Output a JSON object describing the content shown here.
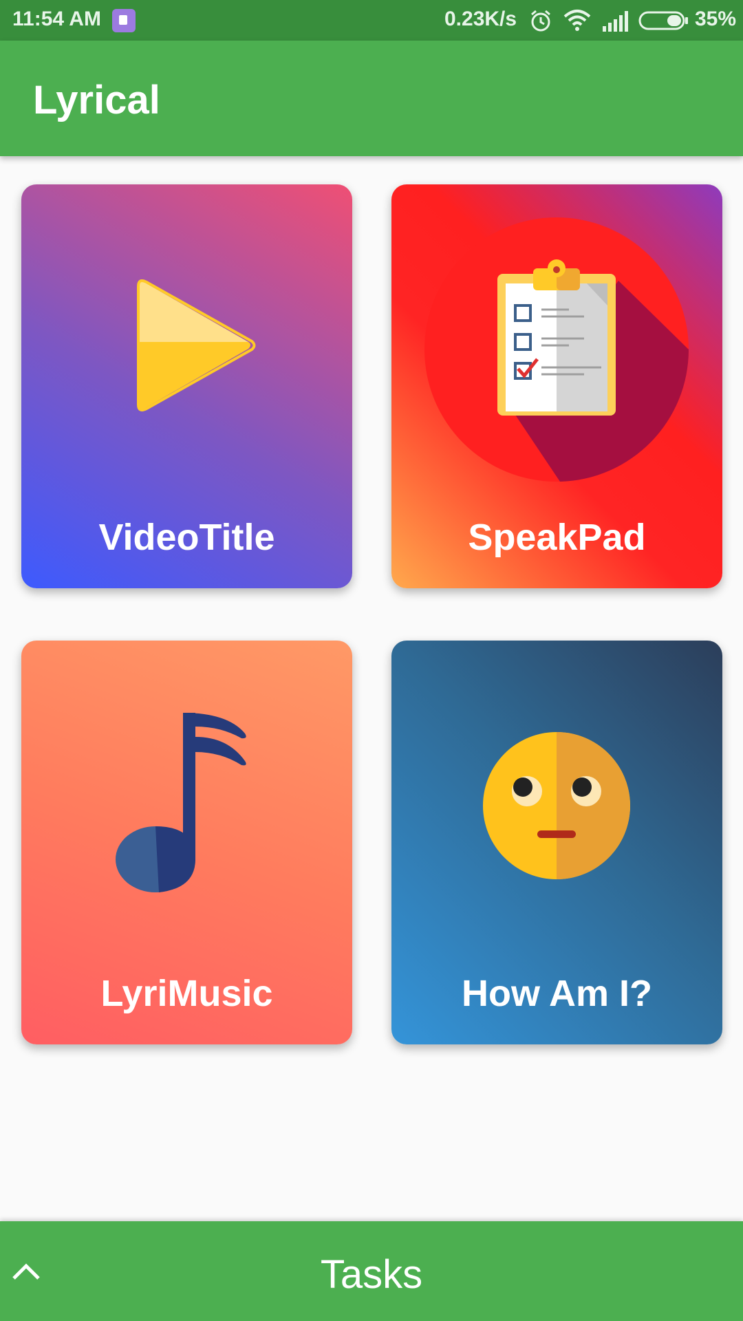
{
  "status_bar": {
    "time": "11:54 AM",
    "network_speed": "0.23K/s",
    "battery": "35%",
    "icons": [
      "notification-app-icon",
      "alarm-icon",
      "wifi-icon",
      "signal-icon",
      "battery-icon"
    ]
  },
  "app_bar": {
    "title": "Lyrical"
  },
  "cards": [
    {
      "label": "VideoTitle",
      "icon": "play-icon"
    },
    {
      "label": "SpeakPad",
      "icon": "clipboard-checklist-icon"
    },
    {
      "label": "LyriMusic",
      "icon": "music-note-icon"
    },
    {
      "label": "How Am I?",
      "icon": "eye-roll-emoji-icon"
    }
  ],
  "bottom_bar": {
    "label": "Tasks",
    "icon": "chevron-up-icon"
  },
  "colors": {
    "status_bar": "#388e3c",
    "app_bar": "#4caf50",
    "bottom_bar": "#4caf50",
    "background": "#fafafa"
  }
}
